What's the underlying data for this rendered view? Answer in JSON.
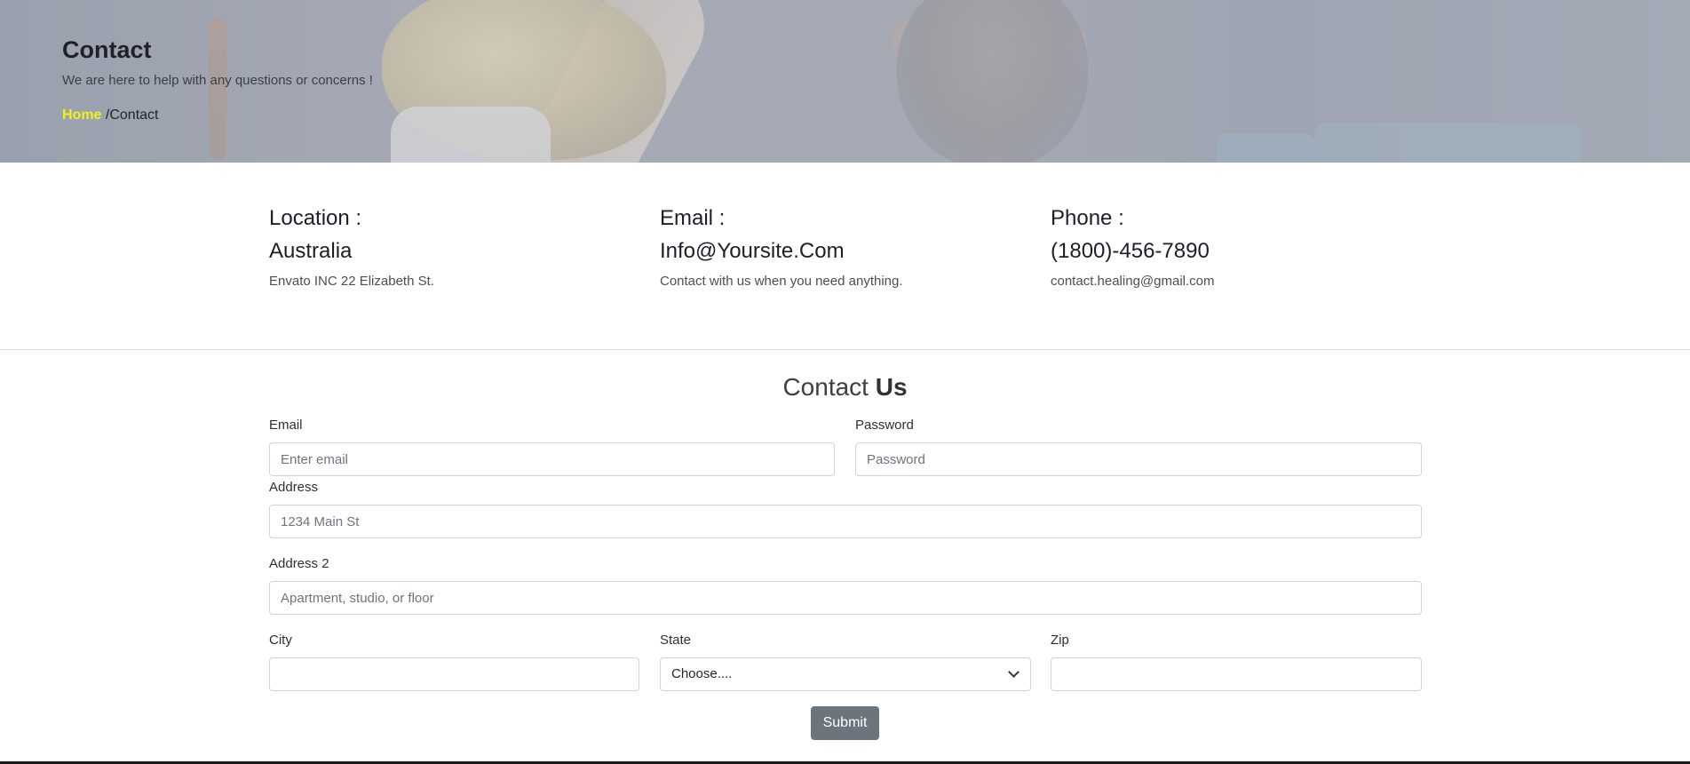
{
  "hero": {
    "title": "Contact",
    "subtitle": "We are here to help with any questions or concerns !",
    "breadcrumb": {
      "home": "Home",
      "separator": " /",
      "current": "Contact"
    },
    "breadcrumb_home_color": "#f2f21a"
  },
  "info": [
    {
      "heading": "Location :",
      "value": "Australia",
      "detail": "Envato INC 22 Elizabeth St."
    },
    {
      "heading": "Email :",
      "value": "Info@Yoursite.Com",
      "detail": "Contact with us when you need anything."
    },
    {
      "heading": "Phone :",
      "value": "(1800)-456-7890",
      "detail": "contact.healing@gmail.com"
    }
  ],
  "form": {
    "title_plain": "Contact ",
    "title_bold": "Us",
    "email": {
      "label": "Email",
      "placeholder": "Enter email",
      "value": ""
    },
    "password": {
      "label": "Password",
      "placeholder": "Password",
      "value": ""
    },
    "address": {
      "label": "Address",
      "placeholder": "1234 Main St",
      "value": ""
    },
    "address2": {
      "label": "Address 2",
      "placeholder": "Apartment, studio, or floor",
      "value": ""
    },
    "city": {
      "label": "City",
      "value": ""
    },
    "state": {
      "label": "State",
      "selected": "Choose...."
    },
    "zip": {
      "label": "Zip",
      "value": ""
    },
    "submit_label": "Submit",
    "submit_color": "#6c757d"
  }
}
